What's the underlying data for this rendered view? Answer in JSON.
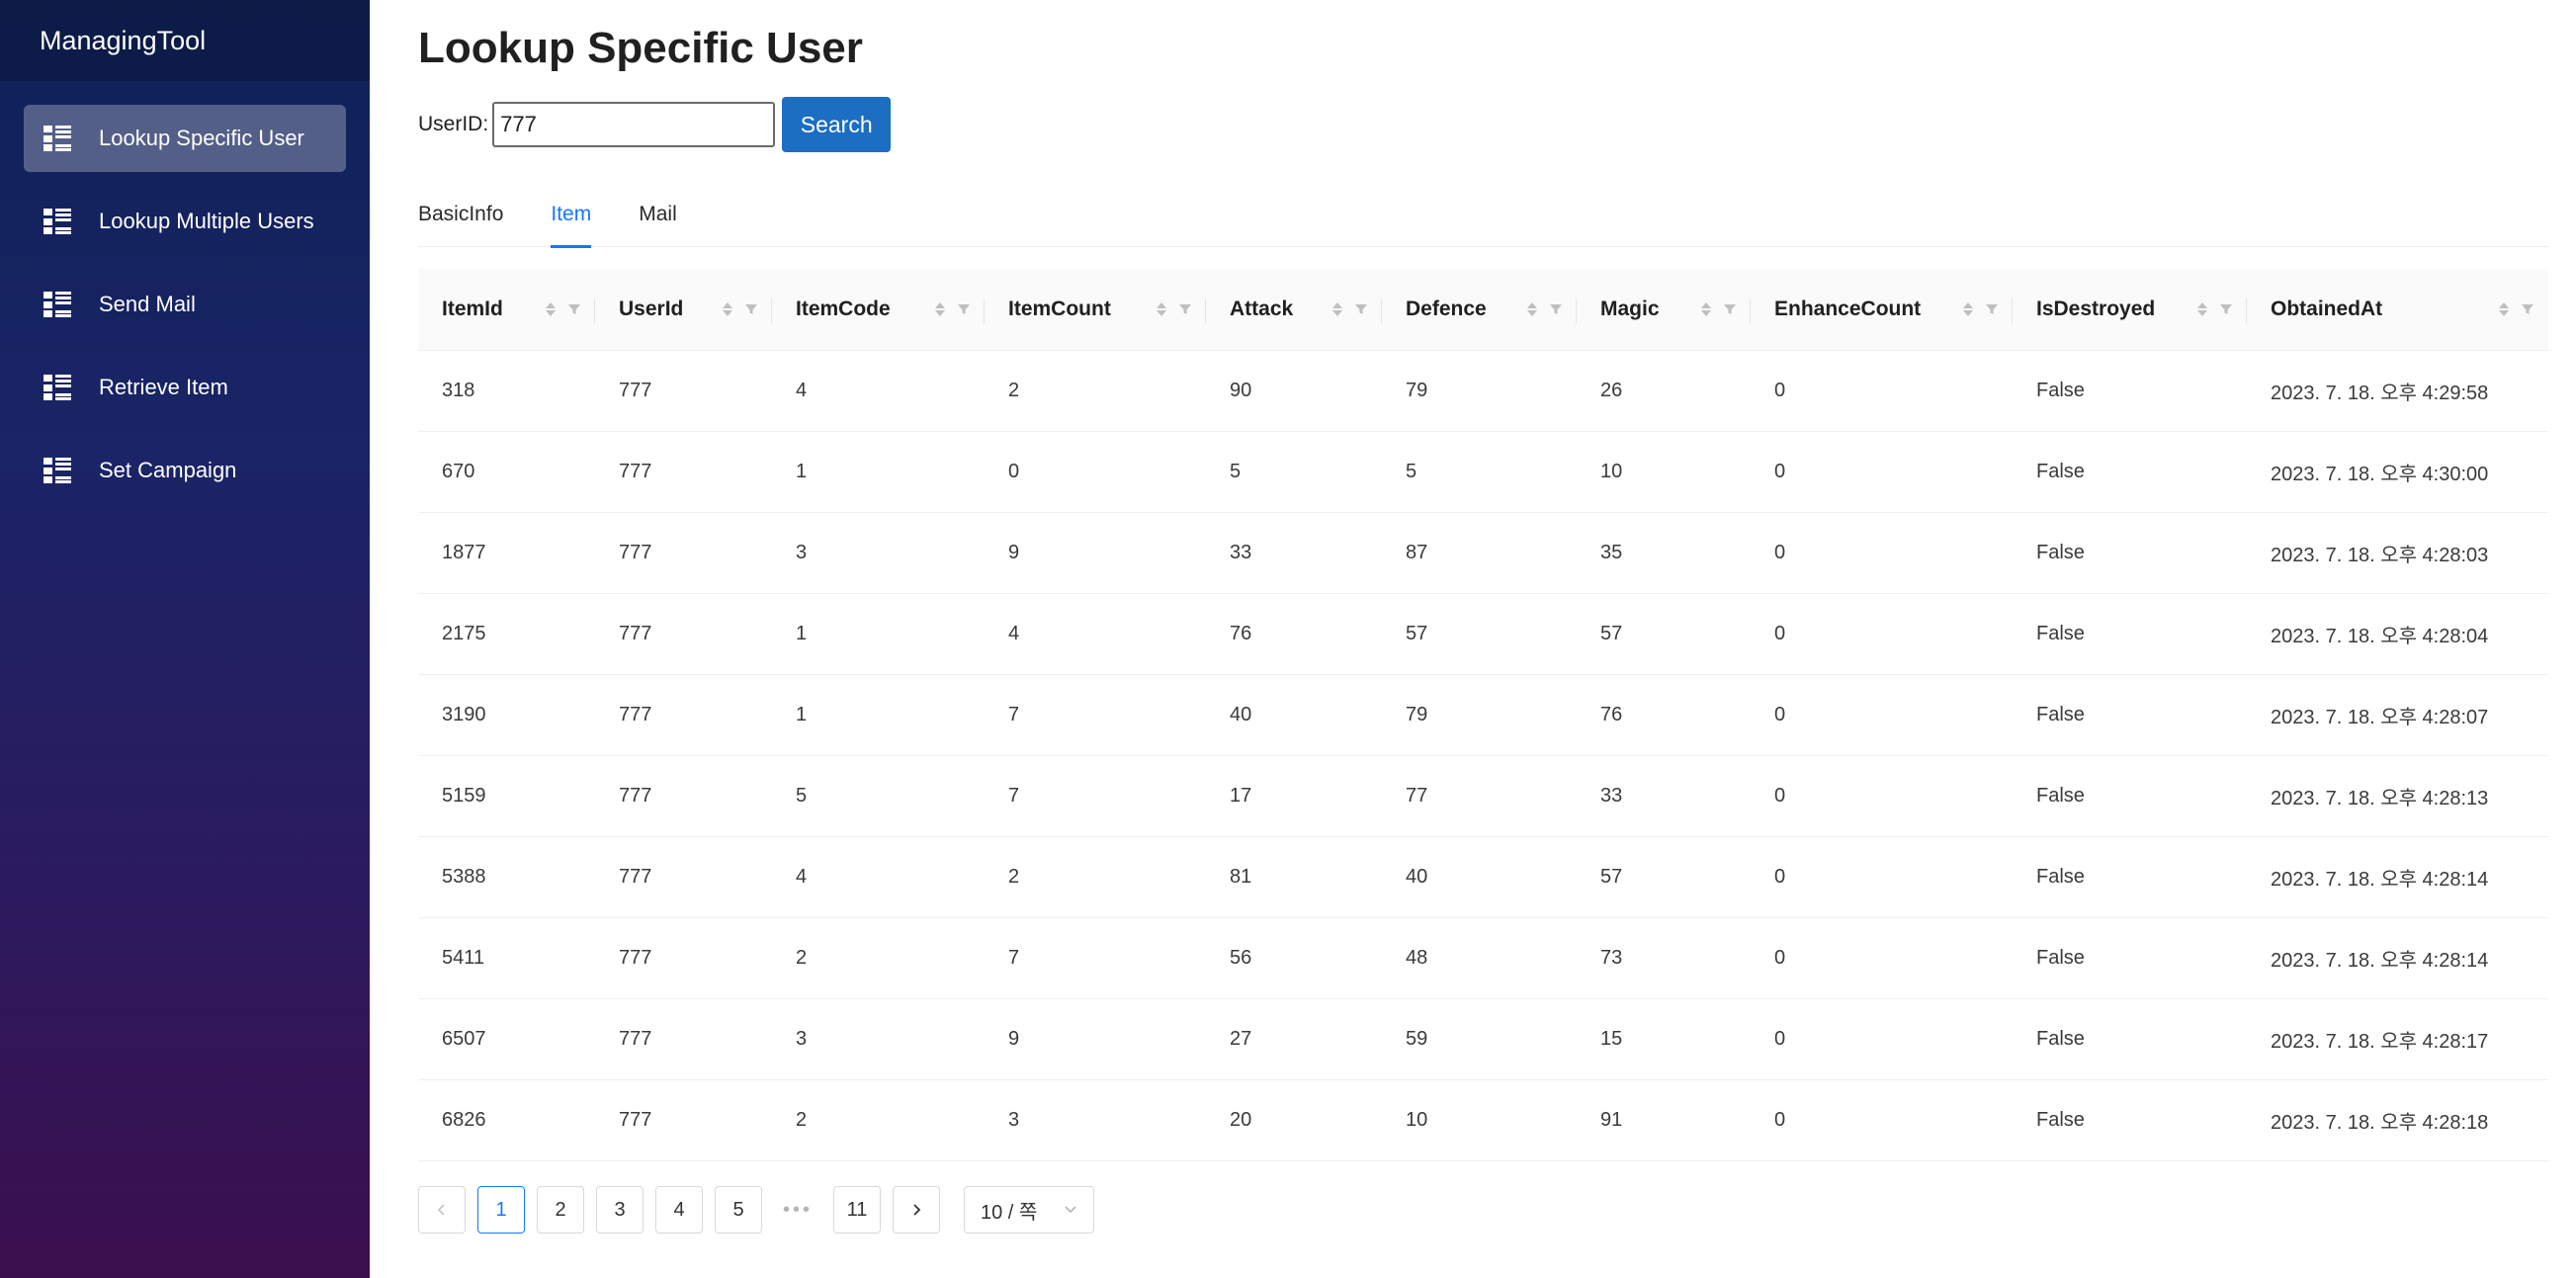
{
  "app": {
    "title": "ManagingTool"
  },
  "sidebar": {
    "items": [
      {
        "label": "Lookup Specific User",
        "icon": "list-icon",
        "active": true
      },
      {
        "label": "Lookup Multiple Users",
        "icon": "list-icon",
        "active": false
      },
      {
        "label": "Send Mail",
        "icon": "list-icon",
        "active": false
      },
      {
        "label": "Retrieve Item",
        "icon": "list-icon",
        "active": false
      },
      {
        "label": "Set Campaign",
        "icon": "list-icon",
        "active": false
      }
    ]
  },
  "page": {
    "title": "Lookup Specific User"
  },
  "search": {
    "label": "UserID:",
    "value": "777",
    "button_label": "Search"
  },
  "tabs": [
    {
      "label": "BasicInfo",
      "active": false
    },
    {
      "label": "Item",
      "active": true
    },
    {
      "label": "Mail",
      "active": false
    }
  ],
  "table": {
    "columns": [
      "ItemId",
      "UserId",
      "ItemCode",
      "ItemCount",
      "Attack",
      "Defence",
      "Magic",
      "EnhanceCount",
      "IsDestroyed",
      "ObtainedAt"
    ],
    "rows": [
      [
        "318",
        "777",
        "4",
        "2",
        "90",
        "79",
        "26",
        "0",
        "False",
        "2023. 7. 18. 오후 4:29:58"
      ],
      [
        "670",
        "777",
        "1",
        "0",
        "5",
        "5",
        "10",
        "0",
        "False",
        "2023. 7. 18. 오후 4:30:00"
      ],
      [
        "1877",
        "777",
        "3",
        "9",
        "33",
        "87",
        "35",
        "0",
        "False",
        "2023. 7. 18. 오후 4:28:03"
      ],
      [
        "2175",
        "777",
        "1",
        "4",
        "76",
        "57",
        "57",
        "0",
        "False",
        "2023. 7. 18. 오후 4:28:04"
      ],
      [
        "3190",
        "777",
        "1",
        "7",
        "40",
        "79",
        "76",
        "0",
        "False",
        "2023. 7. 18. 오후 4:28:07"
      ],
      [
        "5159",
        "777",
        "5",
        "7",
        "17",
        "77",
        "33",
        "0",
        "False",
        "2023. 7. 18. 오후 4:28:13"
      ],
      [
        "5388",
        "777",
        "4",
        "2",
        "81",
        "40",
        "57",
        "0",
        "False",
        "2023. 7. 18. 오후 4:28:14"
      ],
      [
        "5411",
        "777",
        "2",
        "7",
        "56",
        "48",
        "73",
        "0",
        "False",
        "2023. 7. 18. 오후 4:28:14"
      ],
      [
        "6507",
        "777",
        "3",
        "9",
        "27",
        "59",
        "15",
        "0",
        "False",
        "2023. 7. 18. 오후 4:28:17"
      ],
      [
        "6826",
        "777",
        "2",
        "3",
        "20",
        "10",
        "91",
        "0",
        "False",
        "2023. 7. 18. 오후 4:28:18"
      ]
    ]
  },
  "pagination": {
    "prev": "<",
    "pages": [
      "1",
      "2",
      "3",
      "4",
      "5"
    ],
    "ellipsis": "•••",
    "last": "11",
    "next": ">",
    "current": "1",
    "page_size": "10 / 쪽"
  },
  "colors": {
    "accent": "#1677ff",
    "button": "#1b6ec2",
    "sidebar_top": "#0e2156",
    "sidebar_bottom": "#3b0f4e"
  }
}
